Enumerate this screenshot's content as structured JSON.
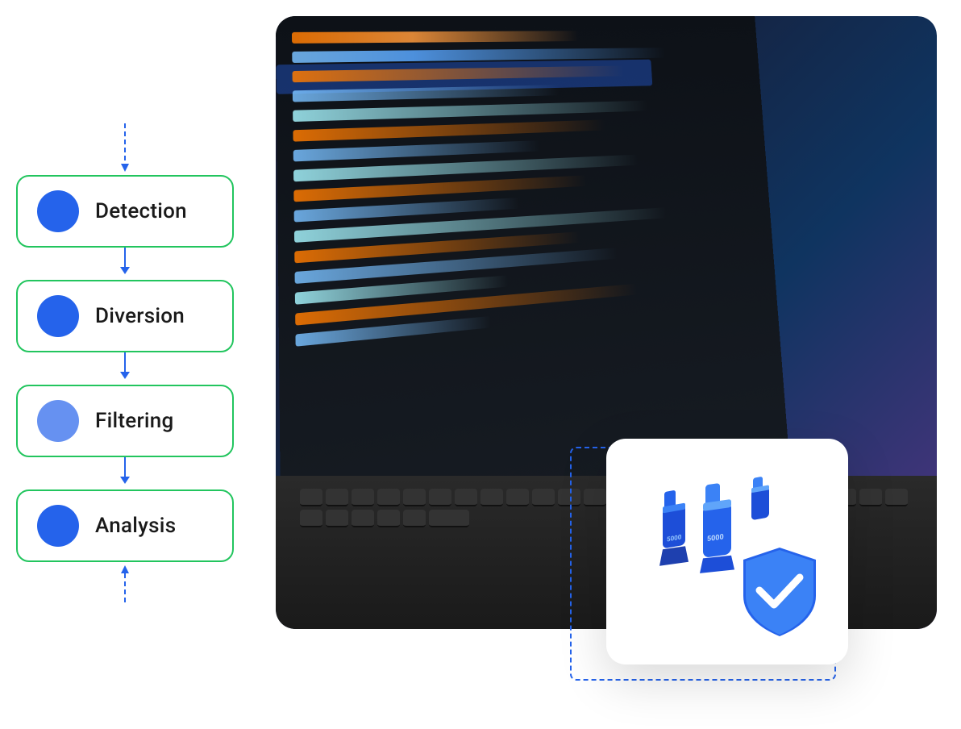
{
  "flow": {
    "steps": [
      {
        "id": "detection",
        "label": "Detection"
      },
      {
        "id": "diversion",
        "label": "Diversion"
      },
      {
        "id": "filtering",
        "label": "Filtering"
      },
      {
        "id": "analysis",
        "label": "Analysis"
      }
    ]
  },
  "image": {
    "alt": "Laptop with code editor"
  },
  "badge": {
    "alt": "Security verification badge"
  },
  "colors": {
    "accent_blue": "#2563eb",
    "border_green": "#22c55e",
    "circle_blue": "#2563eb",
    "text_dark": "#1a1a1a"
  }
}
